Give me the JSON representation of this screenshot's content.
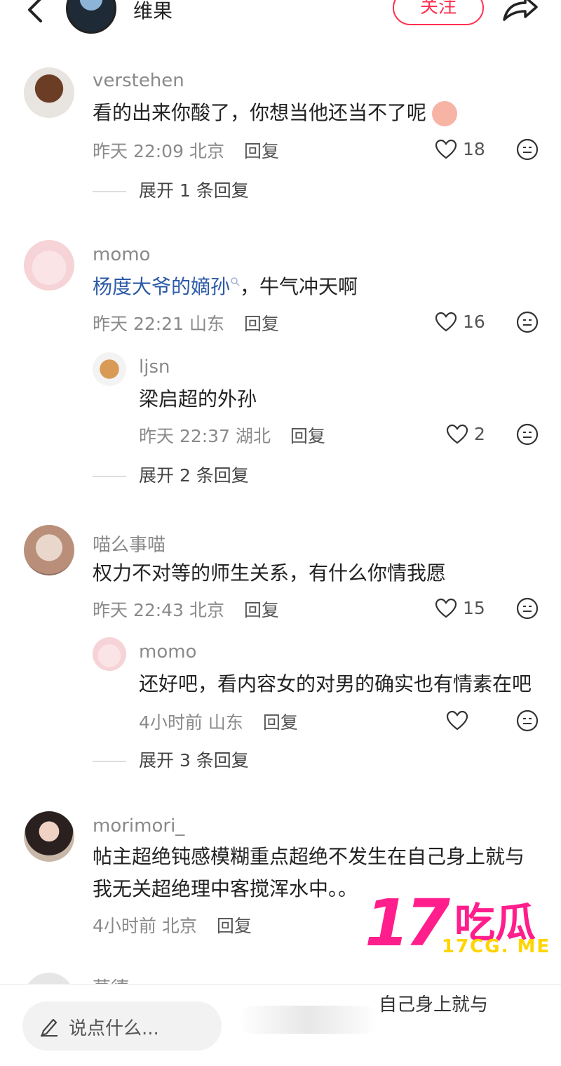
{
  "header": {
    "author": "维果",
    "follow_label": "关注"
  },
  "comments": [
    {
      "name": "verstehen",
      "text": "看的出来你酸了，你想当他还当不了呢",
      "time": "昨天 22:09",
      "loc": "北京",
      "reply": "回复",
      "likes": "18",
      "expand": "展开 1 条回复"
    },
    {
      "name": "momo",
      "link": "杨度大爷的嫡孙",
      "text_after": "，牛气冲天啊",
      "time": "昨天 22:21",
      "loc": "山东",
      "reply": "回复",
      "likes": "16",
      "sub": {
        "name": "ljsn",
        "text": "梁启超的外孙",
        "time": "昨天 22:37",
        "loc": "湖北",
        "reply": "回复",
        "likes": "2"
      },
      "expand": "展开 2 条回复"
    },
    {
      "name": "喵么事喵",
      "text": "权力不对等的师生关系，有什么你情我愿",
      "time": "昨天 22:43",
      "loc": "北京",
      "reply": "回复",
      "likes": "15",
      "sub": {
        "name": "momo",
        "text": "还好吧，看内容女的对男的确实也有情素在吧",
        "time": "4小时前",
        "loc": "山东",
        "reply": "回复"
      },
      "expand": "展开 3 条回复"
    },
    {
      "name": "morimori_",
      "text1": "帖主超绝钝感模糊重点超绝不发生在自己身上就与",
      "text2": "我无关超绝理中客搅浑水中。。",
      "time": "4小时前",
      "loc": "北京",
      "reply": "回复"
    }
  ],
  "partial_name": "草德",
  "bottom": {
    "placeholder": "说点什么...",
    "overlay_text": "自己身上就与"
  },
  "watermark": {
    "big": "17",
    "cn": "吃瓜",
    "url": "17CG. ME"
  },
  "colors": {
    "accent": "#ff2f4f",
    "link": "#2b5aa6",
    "watermark": "#ff1e8c"
  }
}
